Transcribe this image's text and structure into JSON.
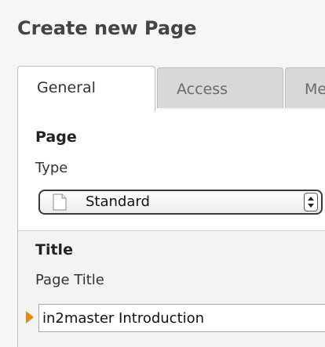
{
  "header": {
    "title": "Create new Page"
  },
  "tabs": [
    {
      "label": "General",
      "active": true
    },
    {
      "label": "Access",
      "active": false
    },
    {
      "label": "Me",
      "active": false
    }
  ],
  "sections": {
    "page": {
      "heading": "Page",
      "type_label": "Type",
      "type_select": {
        "value": "Standard",
        "icon": "document-icon"
      }
    },
    "title": {
      "heading": "Title",
      "page_title_label": "Page Title",
      "page_title_value": "in2master Introduction",
      "marker_icon": "triangle-right-icon"
    }
  },
  "colors": {
    "marker": "#e88a00",
    "title_text": "#444444",
    "inactive_tab": "#d8d8d8"
  }
}
